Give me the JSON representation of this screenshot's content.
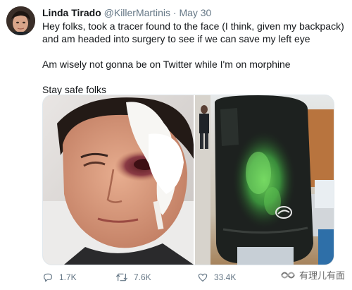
{
  "tweet": {
    "display_name": "Linda Tirado",
    "handle": "@KillerMartinis",
    "separator": "·",
    "date": "May 30",
    "paragraphs": [
      "Hey folks, took a tracer found to the face (I think, given my backpack) and am headed into surgery to see if we can save my left eye",
      "Am wisely not gonna be on Twitter while I'm on morphine",
      "Stay safe folks"
    ]
  },
  "actions": {
    "reply_count": "1.7K",
    "retweet_count": "7.6K",
    "like_count": "33.4K"
  },
  "icons": {
    "reply": "reply-icon",
    "retweet": "retweet-icon",
    "like": "heart-icon",
    "watermark": "brand-logo-icon"
  },
  "watermark": {
    "text": "有理儿有面"
  },
  "colors": {
    "text_primary": "#14171a",
    "text_secondary": "#657786",
    "backpack_stain": "#5fc24a"
  }
}
